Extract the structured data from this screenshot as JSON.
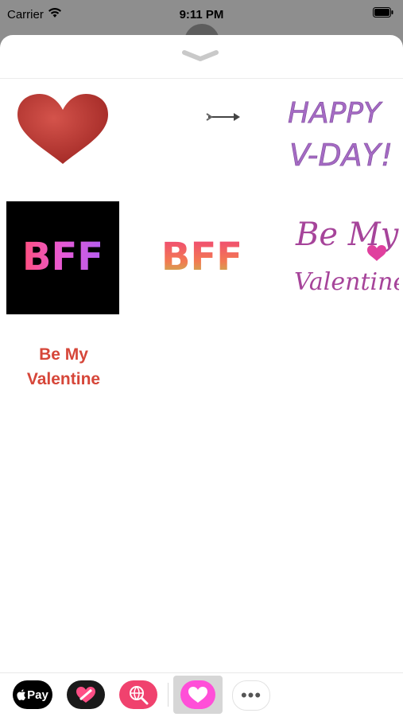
{
  "status_bar": {
    "carrier": "Carrier",
    "time": "9:11 PM"
  },
  "stickers": {
    "happy_vday_line1": "HAPPY",
    "happy_vday_line2": "V-DAY!",
    "bff_black": "BFF",
    "bff": "BFF",
    "be_my_script_line1": "Be My",
    "be_my_script_line2": "Valentine",
    "be_my_text_line1": "Be My",
    "be_my_text_line2": "Valentine"
  },
  "app_drawer": {
    "apple_pay_label": "Pay",
    "more_label": "•••"
  },
  "colors": {
    "heart_red": "#b3302c",
    "bff_pink": "#ee4a8a",
    "script_purple": "#a56bc4",
    "be_my_text_red": "#d64639",
    "selected_app_pink": "#ff4fd8"
  }
}
